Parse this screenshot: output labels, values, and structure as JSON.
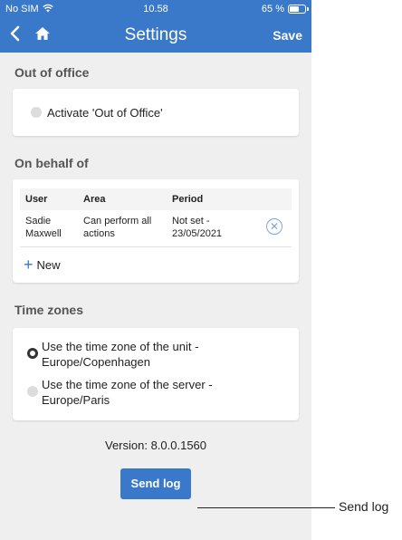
{
  "status_bar": {
    "carrier": "No SIM",
    "time": "10.58",
    "battery_text": "65 %",
    "battery_level": 0.65
  },
  "nav": {
    "title": "Settings",
    "save_label": "Save",
    "back_icon": "chevron-left-icon",
    "home_icon": "home-icon"
  },
  "out_of_office": {
    "title": "Out of office",
    "activate_label": "Activate 'Out of Office'",
    "checked": false
  },
  "on_behalf_of": {
    "title": "On behalf of",
    "columns": [
      "User",
      "Area",
      "Period"
    ],
    "rows": [
      {
        "user": "Sadie Maxwell",
        "area": "Can perform all actions",
        "period": "Not set - 23/05/2021"
      }
    ],
    "new_label": "New"
  },
  "time_zones": {
    "title": "Time zones",
    "options": [
      {
        "label": "Use the time zone of the unit - Europe/Copenhagen",
        "selected": true
      },
      {
        "label": "Use the time zone of the server - Europe/Paris",
        "selected": false
      }
    ]
  },
  "version_text": "Version: 8.0.0.1560",
  "send_log_label": "Send log",
  "callout_label": "Send log",
  "colors": {
    "accent": "#3a78c9",
    "background": "#efefef"
  }
}
